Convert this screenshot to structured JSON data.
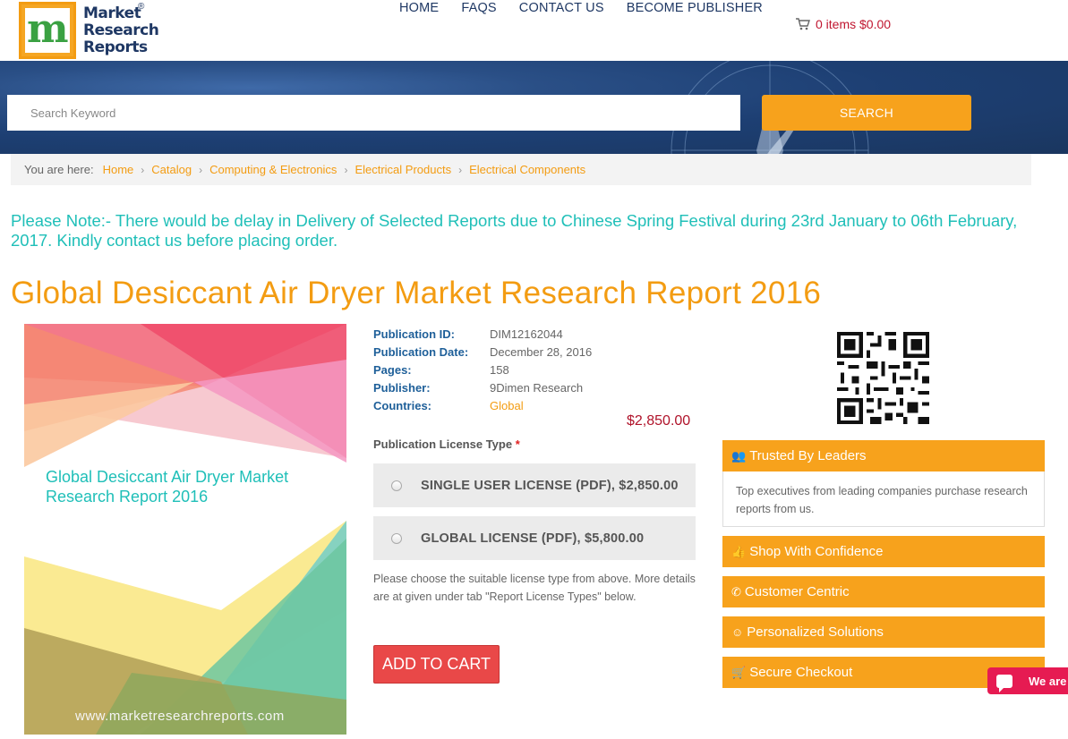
{
  "logo": {
    "line1": "Market",
    "line2": "Research",
    "line3": "Reports",
    "reg": "®"
  },
  "nav": [
    {
      "label": "HOME"
    },
    {
      "label": "FAQS"
    },
    {
      "label": "CONTACT US"
    },
    {
      "label": "BECOME PUBLISHER"
    }
  ],
  "cart": {
    "label": "0 items $0.00"
  },
  "search": {
    "placeholder": "Search Keyword",
    "button": "SEARCH"
  },
  "breadcrumb": {
    "prefix": "You are here:",
    "items": [
      "Home",
      "Catalog",
      "Computing & Electronics",
      "Electrical Products",
      "Electrical Components"
    ]
  },
  "notice": "Please Note:- There would be delay in Delivery of Selected Reports due to Chinese Spring Festival during 23rd January to 06th February, 2017. Kindly contact us before placing order.",
  "title": "Global Desiccant Air Dryer Market Research Report 2016",
  "cover": {
    "title": "Global Desiccant Air Dryer Market Research Report 2016",
    "url": "www.marketresearchreports.com"
  },
  "details": [
    {
      "label": "Publication ID:",
      "value": "DIM12162044"
    },
    {
      "label": "Publication Date:",
      "value": "December 28, 2016"
    },
    {
      "label": "Pages:",
      "value": "158"
    },
    {
      "label": "Publisher:",
      "value": "9Dimen Research"
    },
    {
      "label": "Countries:",
      "value": "Global"
    }
  ],
  "price": "$2,850.00",
  "license": {
    "label": "Publication License Type",
    "required": "*",
    "options": [
      {
        "label": "SINGLE USER LICENSE (PDF), $2,850.00"
      },
      {
        "label": "GLOBAL LICENSE (PDF), $5,800.00"
      }
    ],
    "note": "Please choose the suitable license type from above. More details are at given under tab \"Report License Types\" below."
  },
  "add_to_cart": "ADD TO CART",
  "side": {
    "trusted_title": "Trusted By Leaders",
    "trusted_body": "Top executives from leading companies purchase research reports from us.",
    "boxes": [
      {
        "label": "Shop With Confidence",
        "icon": "thumbs-up-icon"
      },
      {
        "label": "Customer Centric",
        "icon": "phone-icon"
      },
      {
        "label": "Personalized Solutions",
        "icon": "smile-icon"
      },
      {
        "label": "Secure Checkout",
        "icon": "cart-icon"
      }
    ]
  },
  "chat": {
    "label": "We are"
  },
  "colors": {
    "accent": "#f7a21c",
    "teal": "#1fbfb8",
    "navy": "#1f3864",
    "price": "#b0132a",
    "cart_button": "#e94848"
  }
}
